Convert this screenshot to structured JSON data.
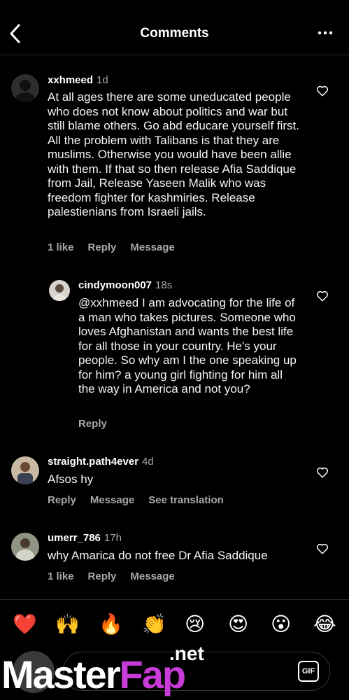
{
  "header": {
    "title": "Comments"
  },
  "comments": [
    {
      "username": "xxhmeed",
      "time": "1d",
      "text": "At all ages there are some uneducated people who does not know about politics and war but still blame others. Go abd educare yourself first. All the problem with Talibans is that they are muslims. Otherwise you would have been allie with them. If that so then release Afia Saddique from Jail, Release Yaseen Malik who was freedom fighter for kashmiries. Release palestienians from Israeli jails.",
      "likes": "1 like",
      "reply": "Reply",
      "message": "Message"
    },
    {
      "username": "cindymoon007",
      "time": "18s",
      "text": "@xxhmeed I am advocating for the life of a man who takes pictures. Someone who loves Afghanistan and wants the best life for all those in your country. He's your people. So why am I the one speaking up for him? a young girl fighting for him all the way in America and not you?",
      "reply": "Reply"
    },
    {
      "username": "straight.path4ever",
      "time": "4d",
      "text": "Afsos hy",
      "reply": "Reply",
      "message": "Message",
      "translation": "See translation"
    },
    {
      "username": "umerr_786",
      "time": "17h",
      "text": "why Amarica do not free Dr Afia Saddique",
      "likes": "1 like",
      "reply": "Reply",
      "message": "Message"
    }
  ],
  "emoji_bar": [
    "❤️",
    "🙌",
    "🔥",
    "👏",
    "😢",
    "😍",
    "😮",
    "😂"
  ],
  "input": {
    "gif_label": "GIF"
  },
  "watermark": {
    "part1": "Master",
    "part2": "Fap",
    "suffix": ".net"
  },
  "colors": {
    "background": "#000000",
    "muted": "#a8a8a8",
    "watermark_accent": "#c73cd8"
  }
}
